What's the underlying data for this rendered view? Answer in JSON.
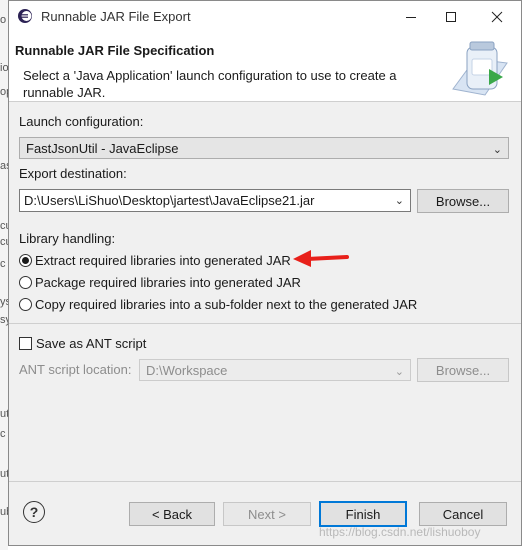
{
  "window": {
    "title": "Runnable JAR File Export",
    "minimize_icon": "minimize-icon",
    "maximize_icon": "maximize-icon",
    "close_icon": "close-icon"
  },
  "header": {
    "title": "Runnable JAR File Specification",
    "description": "Select a 'Java Application' launch configuration to use to create a runnable JAR."
  },
  "launch": {
    "label": "Launch configuration:",
    "value": "FastJsonUtil - JavaEclipse"
  },
  "export": {
    "label": "Export destination:",
    "value": "D:\\Users\\LiShuo\\Desktop\\jartest\\JavaEclipse21.jar",
    "browse_label": "Browse..."
  },
  "library": {
    "label": "Library handling:",
    "options": [
      "Extract required libraries into generated JAR",
      "Package required libraries into generated JAR",
      "Copy required libraries into a sub-folder next to the generated JAR"
    ],
    "selected_index": 0
  },
  "ant": {
    "checkbox_label": "Save as ANT script",
    "location_label": "ANT script location:",
    "location_value": "D:\\Workspace",
    "browse_label": "Browse..."
  },
  "footer": {
    "back_label": "< Back",
    "next_label": "Next >",
    "finish_label": "Finish",
    "cancel_label": "Cancel",
    "help_text": "?"
  },
  "watermark": "https://blog.csdn.net/lishuoboy",
  "background_fragments": [
    "o",
    "io",
    "op",
    "as",
    "cu",
    "cu",
    "c",
    "ys",
    "sy",
    "ut",
    "c",
    "ut",
    "ub"
  ],
  "colors": {
    "annotation_arrow": "#e8201a",
    "focus_border": "#0078d7"
  }
}
